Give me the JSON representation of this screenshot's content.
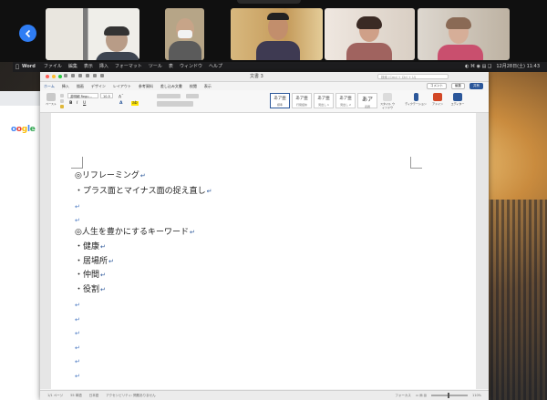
{
  "menubar": {
    "app_name": "Word",
    "items": [
      "ファイル",
      "編集",
      "表示",
      "挿入",
      "フォーマット",
      "ツール",
      "表",
      "ウィンドウ",
      "ヘルプ"
    ],
    "clock": "12月28日(土) 11:43"
  },
  "browser": {
    "logo_text": "Google"
  },
  "word": {
    "doc_title": "文書 3",
    "search_placeholder": "検索 (Cmd + Ctrl + U)",
    "tabs": [
      "ホーム",
      "挿入",
      "描画",
      "デザイン",
      "レイアウト",
      "参考資料",
      "差し込み文書",
      "校閲",
      "表示"
    ],
    "active_tab": "ホーム",
    "comment_button": "コメント",
    "edit_button": "編集",
    "share_button": "共有",
    "font_name": "游明朝 Regu...",
    "font_size": "10.5",
    "styles": [
      {
        "sample": "あア亜",
        "name": "標準"
      },
      {
        "sample": "あア亜",
        "name": "行間詰め"
      },
      {
        "sample": "あア亜",
        "name": "見出し 1"
      },
      {
        "sample": "あア亜",
        "name": "見出し 2"
      },
      {
        "sample": "あア",
        "name": "表題"
      }
    ],
    "style_pane_label": "スタイル ウィンドウ",
    "dictation_label": "ディクテーション",
    "addins_label": "アドイン",
    "editor_label": "エディター",
    "paste_label": "ペースト",
    "document_lines": [
      "◎リフレーミング",
      "・プラス面とマイナス面の捉え直し",
      "",
      "◎人生を豊かにするキーワード",
      "・健康",
      "・居場所",
      "・仲間",
      "・役割"
    ],
    "status": {
      "page": "1/1 ページ",
      "words": "55 単語",
      "language": "日本語",
      "accessibility": "アクセシビリティ: 問題ありません",
      "focus": "フォーカス",
      "zoom": "110%"
    }
  },
  "colors": {
    "accent": "#2b579a",
    "back_button": "#2f7df4",
    "paragraph_mark": "#4a78c2"
  }
}
